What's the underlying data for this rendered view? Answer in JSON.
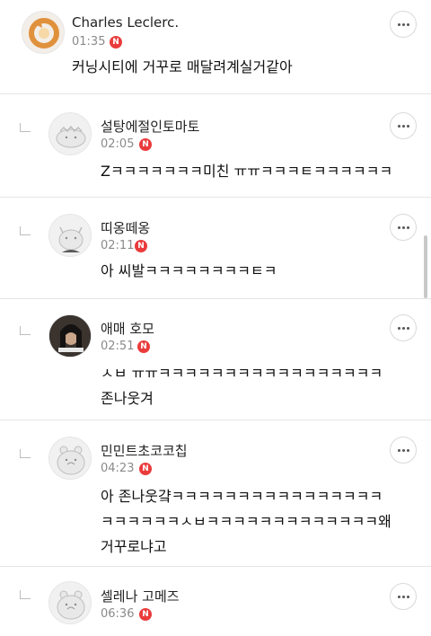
{
  "comments": [
    {
      "nickname": "Charles Leclerc.",
      "time": "01:35",
      "badge": "N",
      "text": "커닝시티에 거꾸로 매달려계실거같아",
      "avatar": "bread-avatar-icon"
    },
    {
      "nickname": "설탕에절인토마토",
      "time": "02:05",
      "badge": "N",
      "text": "Zㅋㅋㅋㅋㅋㅋㅋ미친 ㅠㅠㅋㅋㅋㅌㅋㅋㅋㅋㅋㅋ",
      "avatar": "default-animal-avatar-icon"
    },
    {
      "nickname": "띠옹떼옹",
      "time": "02:11",
      "badge": "N",
      "text": "아 씨발ㅋㅋㅋㅋㅋㅋㅋㅋㅌㅋ",
      "avatar": "default-cat-avatar-icon"
    },
    {
      "nickname": "애매 호모",
      "time": "02:51",
      "badge": "N",
      "text_lines": [
        "ㅅㅂ ㅠㅠㅋㅋㅋㅋㅋㅋㅋㅋㅋㅋㅋㅋㅋㅋㅋㅋㅋ",
        "존나웃겨"
      ],
      "avatar": "photo-avatar-icon"
    },
    {
      "nickname": "민민트초코코칩",
      "time": "04:23",
      "badge": "N",
      "text_lines": [
        "아 존나웃걐ㅋㅋㅋㅋㅋㅋㅋㅋㅋㅋㅋㅋㅋㅋㅋㅋ",
        "ㅋㅋㅋㅋㅋㅋㅅㅂㅋㅋㅋㅋㅋㅋㅋㅋㅋㅋㅋㅋㅋ왜",
        "거꾸로냐고"
      ],
      "avatar": "default-hamster-avatar-icon"
    },
    {
      "nickname": "셀레나 고메즈",
      "time": "06:36",
      "badge": "N",
      "avatar": "default-hamster-avatar-icon"
    }
  ],
  "colors": {
    "badge": "#ea3b3b",
    "divider": "#e5e5e5",
    "time": "#8a8a8a"
  }
}
